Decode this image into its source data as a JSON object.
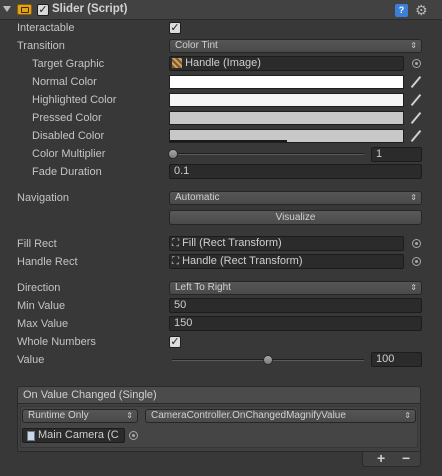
{
  "component": {
    "title": "Slider (Script)",
    "enabled": true,
    "icons": [
      "fold-arrow-icon",
      "script-icon",
      "help-icon",
      "gear-icon"
    ]
  },
  "fields": {
    "interactable": {
      "label": "Interactable",
      "checked": true
    },
    "transition": {
      "label": "Transition",
      "value": "Color Tint"
    },
    "target_graphic": {
      "label": "Target Graphic",
      "value": "Handle (Image)"
    },
    "normal_color": {
      "label": "Normal Color",
      "color": "#ffffff"
    },
    "highlighted_color": {
      "label": "Highlighted Color",
      "color": "#f5f5f5"
    },
    "pressed_color": {
      "label": "Pressed Color",
      "color": "#c8c8c8"
    },
    "disabled_color": {
      "label": "Disabled Color",
      "color": "#c8c8c8",
      "alpha": 0.5
    },
    "color_multiplier": {
      "label": "Color Multiplier",
      "value": "1",
      "fraction": 0.0
    },
    "fade_duration": {
      "label": "Fade Duration",
      "value": "0.1"
    },
    "navigation": {
      "label": "Navigation",
      "value": "Automatic"
    },
    "visualize": {
      "label": "Visualize"
    },
    "fill_rect": {
      "label": "Fill Rect",
      "value": "Fill (Rect Transform)"
    },
    "handle_rect": {
      "label": "Handle Rect",
      "value": "Handle (Rect Transform)"
    },
    "direction": {
      "label": "Direction",
      "value": "Left To Right"
    },
    "min_value": {
      "label": "Min Value",
      "value": "50"
    },
    "max_value": {
      "label": "Max Value",
      "value": "150"
    },
    "whole_numbers": {
      "label": "Whole Numbers",
      "checked": true
    },
    "value": {
      "label": "Value",
      "value": "100",
      "fraction": 0.5
    }
  },
  "event": {
    "title": "On Value Changed (Single)",
    "runtime": "Runtime Only",
    "function": "CameraController.OnChangedMagnifyValue",
    "object": "Main Camera (C",
    "add": "+",
    "remove": "−"
  },
  "colors": {
    "panel_bg": "#383838",
    "field_bg": "#2b2b2b",
    "accent_help": "#3c7fd6",
    "script_icon": "#e3a21a"
  }
}
